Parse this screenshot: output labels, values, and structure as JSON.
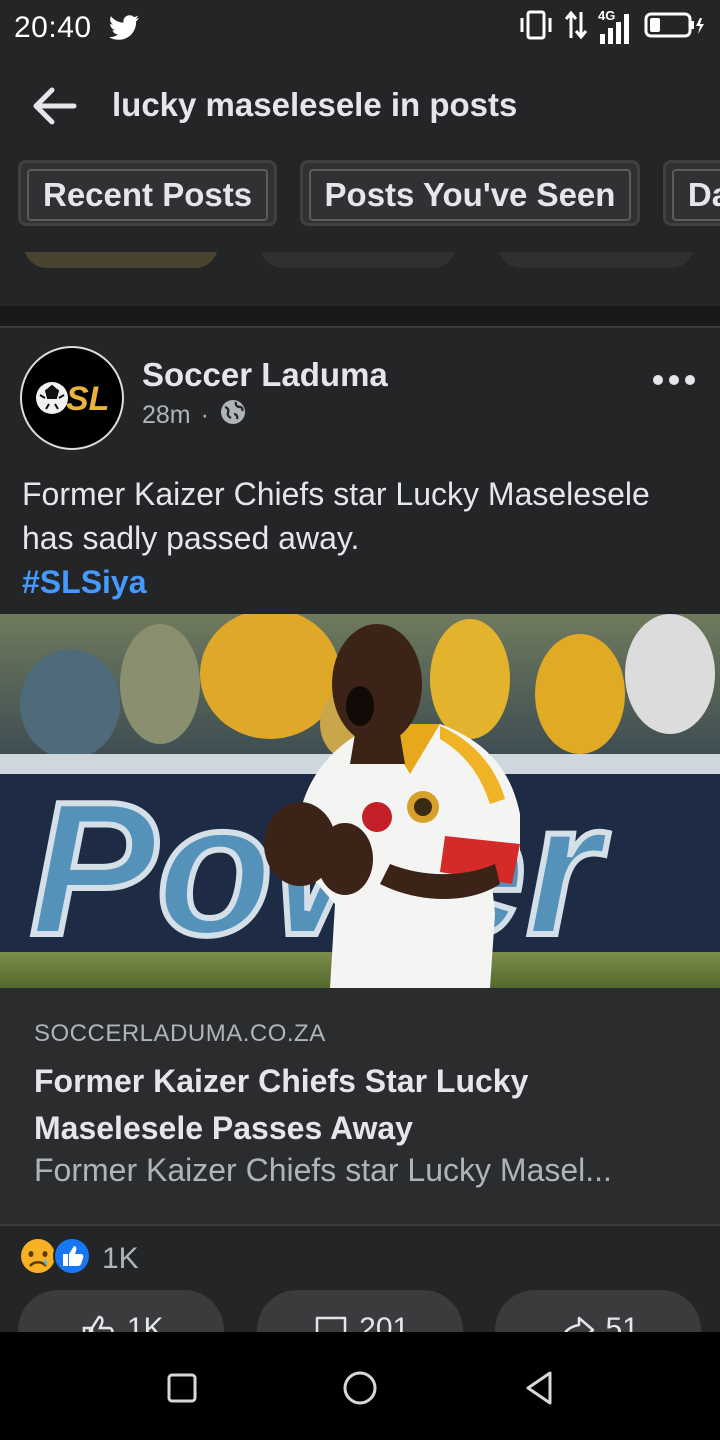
{
  "status_bar": {
    "time": "20:40",
    "network": "4G",
    "icons": [
      "twitter-icon",
      "vibrate-icon",
      "data-arrows-icon",
      "signal-icon",
      "battery-icon"
    ]
  },
  "search": {
    "query": "lucky maselesele in posts",
    "back_icon": "arrow-left-icon"
  },
  "filters": [
    "Recent Posts",
    "Posts You've Seen",
    "Da"
  ],
  "post": {
    "page_name": "Soccer Laduma",
    "avatar_text": "SL",
    "time": "28m",
    "privacy_icon": "globe-icon",
    "text": "Former Kaizer Chiefs star Lucky Maselesele has sadly passed away.",
    "hashtag": "#SLSiya",
    "image_sign_text": "Power",
    "link": {
      "domain": "SOCCERLADUMA.CO.ZA",
      "title": "Former Kaizer Chiefs Star Lucky Maselesele Passes Away",
      "description": "Former Kaizer Chiefs star Lucky Masel..."
    },
    "reactions": {
      "icons": [
        "sad-face-icon",
        "like-icon"
      ],
      "count": "1K"
    },
    "actions": {
      "like": "1K",
      "comment": "201",
      "share": "51"
    }
  },
  "nav": [
    "square-icon",
    "circle-icon",
    "back-triangle-icon"
  ],
  "colors": {
    "background": "#18191a",
    "surface": "#242526",
    "text": "#e4e6eb",
    "muted": "#b0b3b8",
    "hashtag": "#4599ff",
    "like_blue": "#1877f2",
    "sad_yellow": "#f7b125"
  }
}
